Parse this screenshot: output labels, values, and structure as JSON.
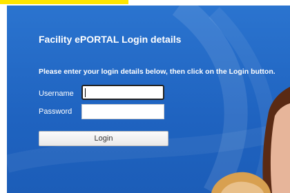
{
  "page": {
    "heading": "Facility ePORTAL Login details",
    "instruction": "Please enter your login details below, then click on the Login button."
  },
  "form": {
    "username_label": "Username",
    "username_value": "",
    "password_label": "Password",
    "password_value": "",
    "login_label": "Login"
  },
  "colors": {
    "panel_blue": "#2368c4",
    "highlight_yellow": "#ffe600",
    "text_white": "#ffffff"
  },
  "icons": {
    "background": "swirl-decoration",
    "photo": "people-photo"
  }
}
